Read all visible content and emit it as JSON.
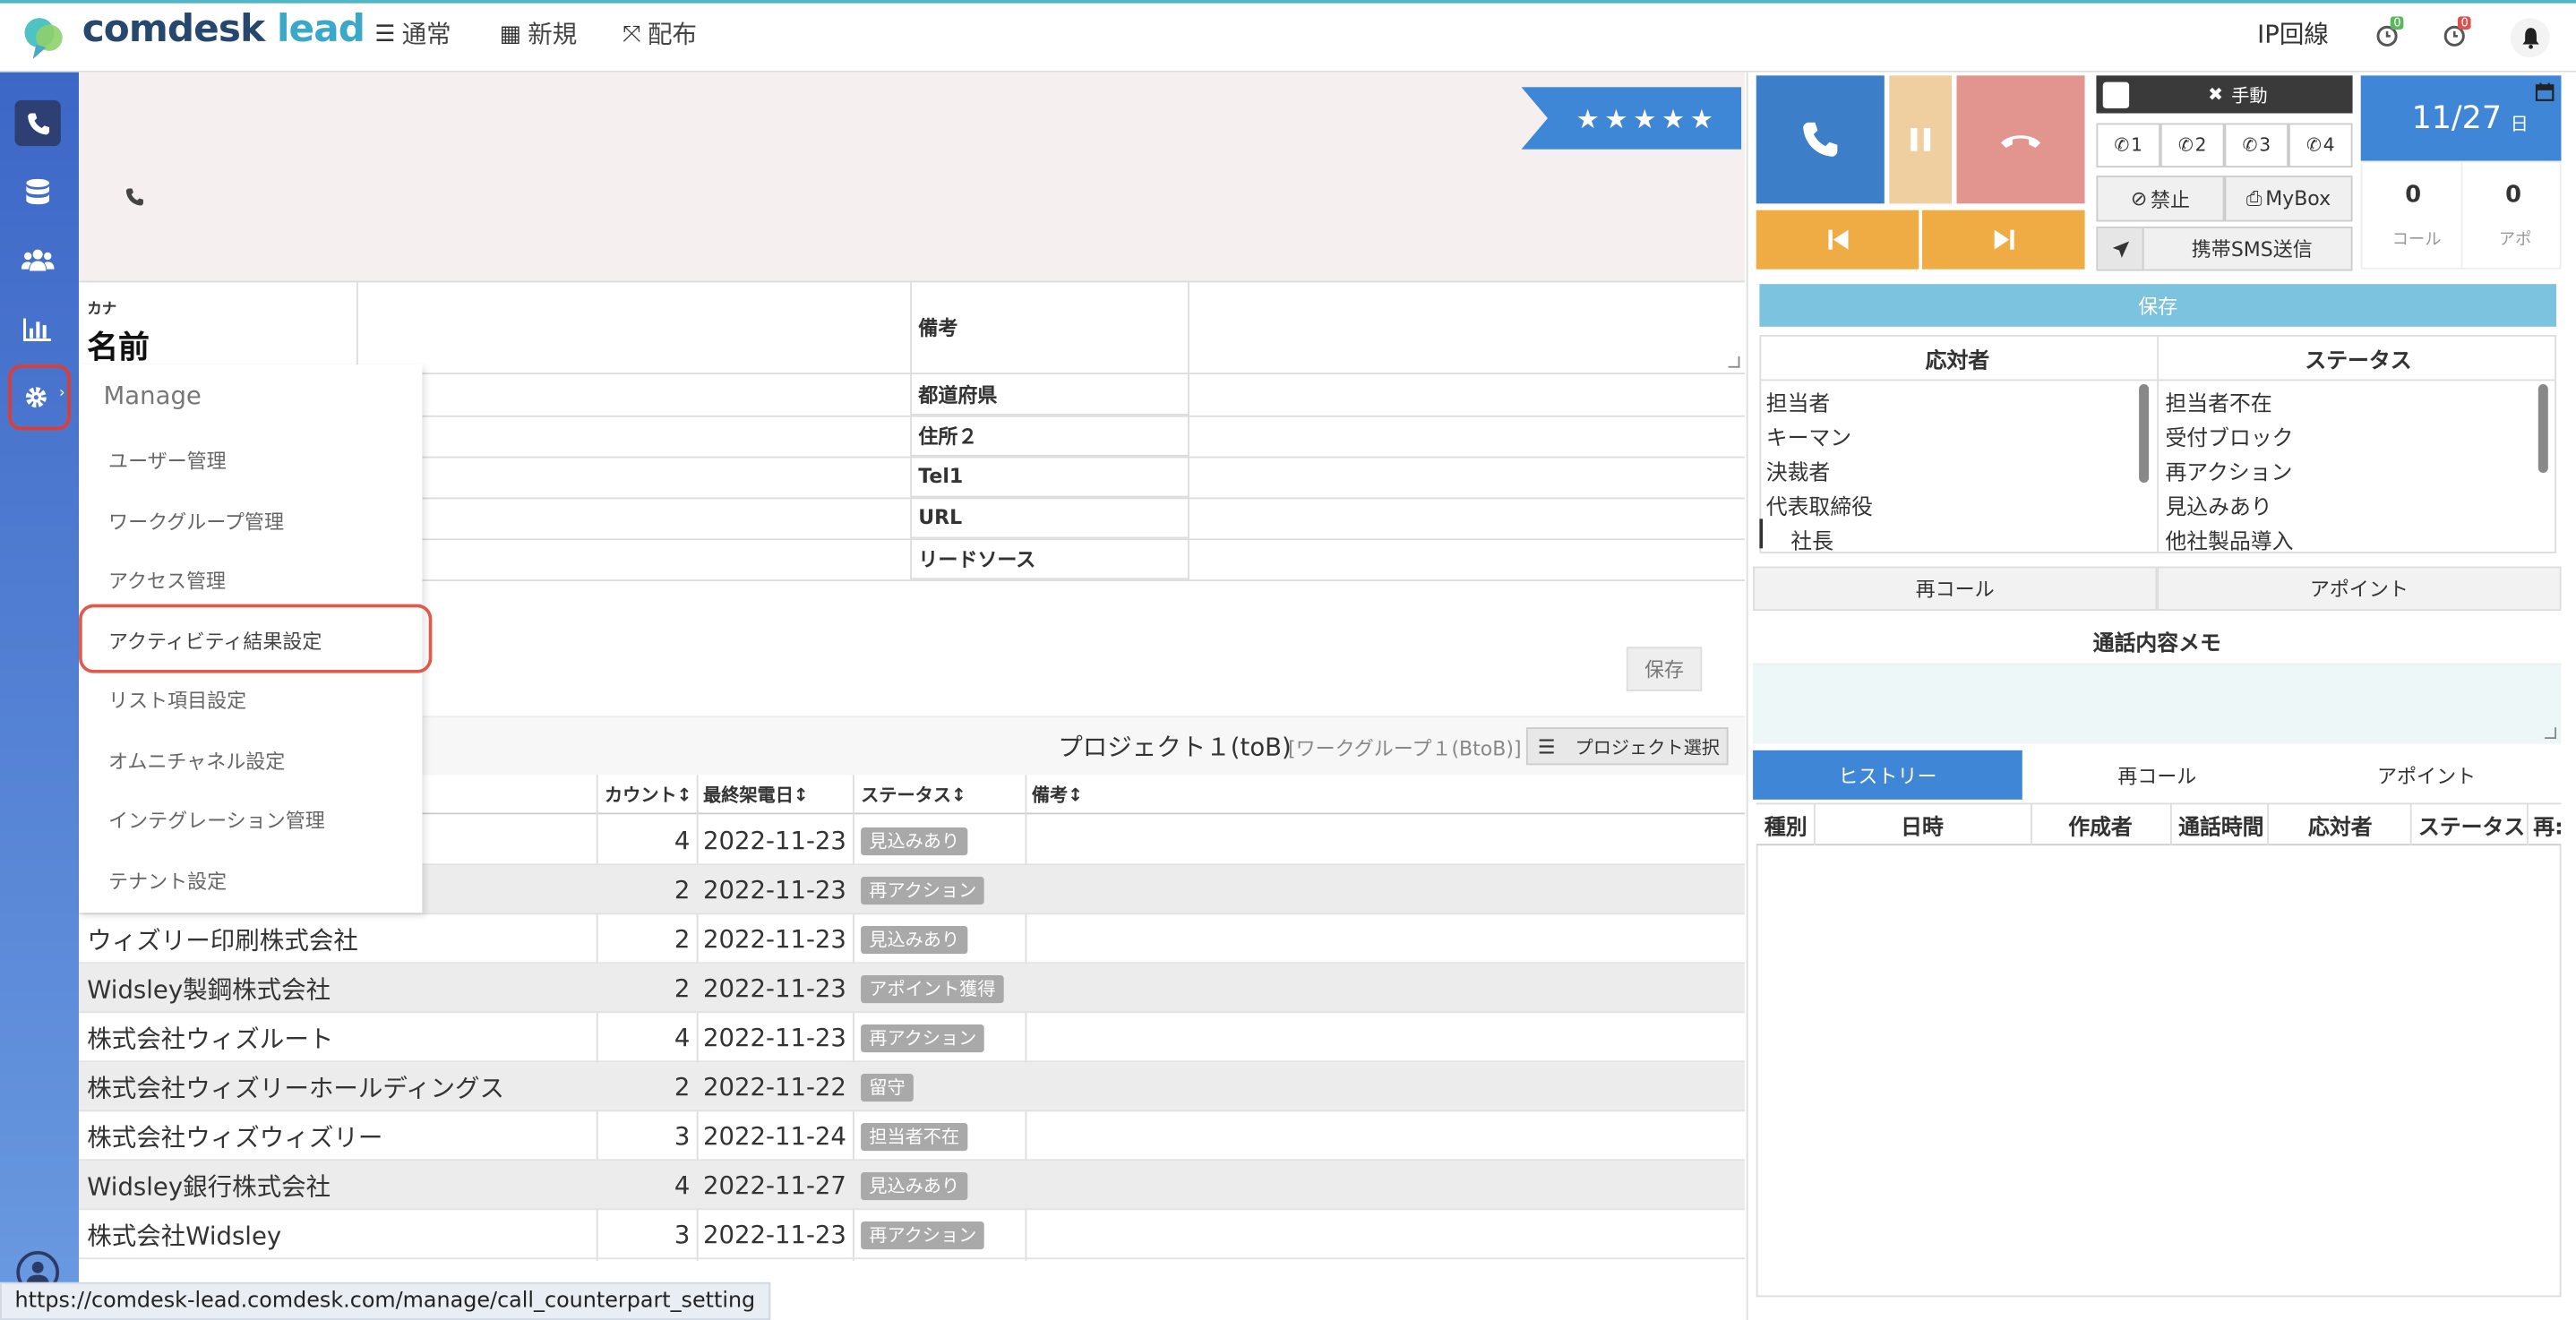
{
  "topbar": {
    "logo_comdesk": "comdesk",
    "logo_lead": "lead",
    "nav_normal": "通常",
    "nav_new": "新規",
    "nav_distribute": "配布",
    "ip_line": "IP回線",
    "badge_green": "0",
    "badge_red": "0"
  },
  "header": {
    "stars": "★★★★★",
    "kana_label": "カナ",
    "name_label": "名前"
  },
  "form": {
    "remarks": "備考",
    "prefecture": "都道府県",
    "address2": "住所２",
    "tel1": "Tel1",
    "url": "URL",
    "lead_source": "リードソース",
    "save": "保存"
  },
  "menu": {
    "title": "Manage",
    "items": [
      "ユーザー管理",
      "ワークグループ管理",
      "アクセス管理",
      "アクティビティ結果設定",
      "リスト項目設定",
      "オムニチャネル設定",
      "インテグレーション管理",
      "テナント設定"
    ]
  },
  "project": {
    "title": "プロジェクト１(toB)",
    "workgroup": "[ワークグループ１(BtoB)]",
    "select_button": "プロジェクト選択"
  },
  "table": {
    "headers": [
      "カウント↕",
      "最終架電日↕",
      "ステータス↕",
      "備考↕"
    ],
    "rows": [
      {
        "name": "",
        "count": "4",
        "date": "2022-11-23",
        "status": "見込みあり"
      },
      {
        "name": "",
        "count": "2",
        "date": "2022-11-23",
        "status": "再アクション"
      },
      {
        "name": "ウィズリー印刷株式会社",
        "count": "2",
        "date": "2022-11-23",
        "status": "見込みあり"
      },
      {
        "name": "Widsley製鋼株式会社",
        "count": "2",
        "date": "2022-11-23",
        "status": "アポイント獲得"
      },
      {
        "name": "株式会社ウィズルート",
        "count": "4",
        "date": "2022-11-23",
        "status": "再アクション"
      },
      {
        "name": "株式会社ウィズリーホールディングス",
        "count": "2",
        "date": "2022-11-22",
        "status": "留守"
      },
      {
        "name": "株式会社ウィズウィズリー",
        "count": "3",
        "date": "2022-11-24",
        "status": "担当者不在"
      },
      {
        "name": "Widsley銀行株式会社",
        "count": "4",
        "date": "2022-11-27",
        "status": "見込みあり"
      },
      {
        "name": "株式会社Widsley",
        "count": "3",
        "date": "2022-11-23",
        "status": "再アクション"
      }
    ]
  },
  "phone": {
    "manual": "手動",
    "lines": [
      "1",
      "2",
      "3",
      "4"
    ],
    "forbid": "禁止",
    "mybox": "MyBox",
    "sms": "携帯SMS送信",
    "date": "11/27",
    "date_suffix": "日",
    "calls_value": "0",
    "calls_label": "コール",
    "appo_value": "0",
    "appo_label": "アポ",
    "save": "保存"
  },
  "responder": {
    "header": "応対者",
    "items": [
      "担当者",
      "キーマン",
      "決裁者",
      "代表取締役",
      "社長"
    ]
  },
  "status_list": {
    "header": "ステータス",
    "items": [
      "担当者不在",
      "受付ブロック",
      "再アクション",
      "見込みあり",
      "他社製品導入"
    ]
  },
  "actions": {
    "recall": "再コール",
    "appoint": "アポイント",
    "memo_title": "通話内容メモ"
  },
  "history": {
    "tabs": [
      "ヒストリー",
      "再コール",
      "アポイント"
    ],
    "columns": [
      "種別",
      "日時",
      "作成者",
      "通話時間",
      "応対者",
      "ステータス",
      "再:"
    ]
  },
  "status_bar": {
    "url": "https://comdesk-lead.comdesk.com/manage/call_counterpart_setting"
  }
}
